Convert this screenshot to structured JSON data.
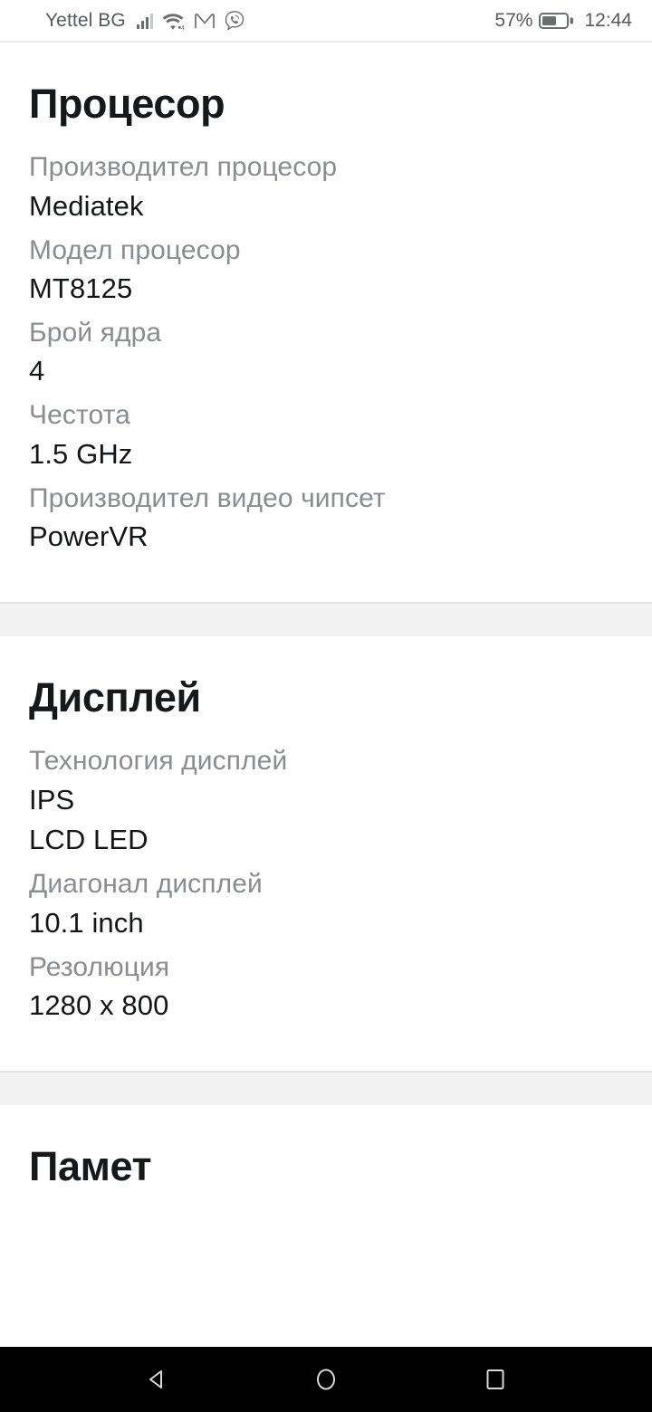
{
  "status_bar": {
    "carrier": "Yettel BG",
    "battery_percent": "57%",
    "clock": "12:44",
    "icons": [
      "signal-bars-icon",
      "wifi-icon",
      "gmail-icon",
      "viber-icon",
      "battery-icon"
    ],
    "wifi_badge": "4"
  },
  "sections": [
    {
      "title": "Процесор",
      "specs": [
        {
          "label": "Производител процесор",
          "value": "Mediatek"
        },
        {
          "label": "Модел процесор",
          "value": "MT8125"
        },
        {
          "label": "Брой ядра",
          "value": "4"
        },
        {
          "label": "Честота",
          "value": "1.5 GHz"
        },
        {
          "label": "Производител видео чипсет",
          "value": "PowerVR"
        }
      ]
    },
    {
      "title": "Дисплей",
      "specs": [
        {
          "label": "Технология дисплей",
          "value": "IPS\nLCD LED"
        },
        {
          "label": "Диагонал дисплей",
          "value": "10.1 inch"
        },
        {
          "label": "Резолюция",
          "value": "1280 x 800"
        }
      ]
    },
    {
      "title": "Памет",
      "specs": []
    }
  ],
  "nav_bar": {
    "back_label": "back-button",
    "home_label": "home-button",
    "recents_label": "recents-button"
  },
  "colors": {
    "label": "#8a8c8f",
    "value": "#141516",
    "heading": "#17181a",
    "band": "#f2f2f2",
    "nav_background": "#000000"
  }
}
